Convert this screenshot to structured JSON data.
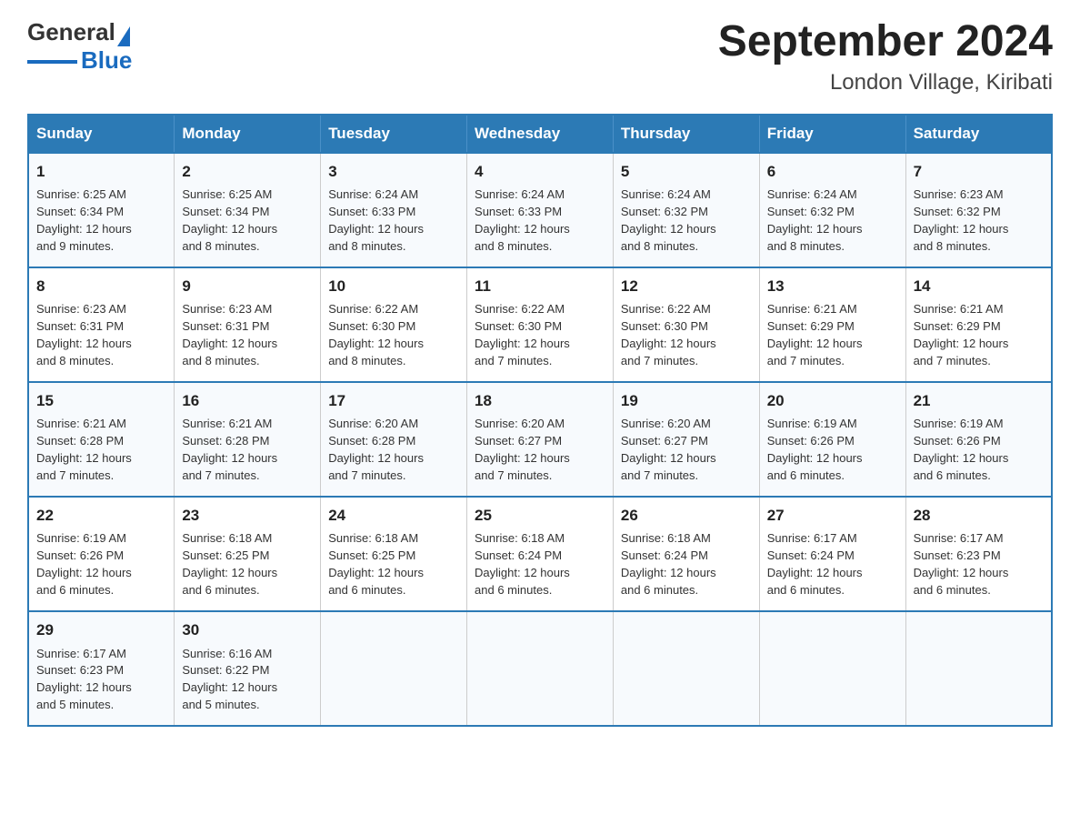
{
  "logo": {
    "text_general": "General",
    "text_blue": "Blue"
  },
  "title": "September 2024",
  "subtitle": "London Village, Kiribati",
  "days_header": [
    "Sunday",
    "Monday",
    "Tuesday",
    "Wednesday",
    "Thursday",
    "Friday",
    "Saturday"
  ],
  "weeks": [
    [
      {
        "day": "1",
        "sunrise": "6:25 AM",
        "sunset": "6:34 PM",
        "daylight": "12 hours and 9 minutes."
      },
      {
        "day": "2",
        "sunrise": "6:25 AM",
        "sunset": "6:34 PM",
        "daylight": "12 hours and 8 minutes."
      },
      {
        "day": "3",
        "sunrise": "6:24 AM",
        "sunset": "6:33 PM",
        "daylight": "12 hours and 8 minutes."
      },
      {
        "day": "4",
        "sunrise": "6:24 AM",
        "sunset": "6:33 PM",
        "daylight": "12 hours and 8 minutes."
      },
      {
        "day": "5",
        "sunrise": "6:24 AM",
        "sunset": "6:32 PM",
        "daylight": "12 hours and 8 minutes."
      },
      {
        "day": "6",
        "sunrise": "6:24 AM",
        "sunset": "6:32 PM",
        "daylight": "12 hours and 8 minutes."
      },
      {
        "day": "7",
        "sunrise": "6:23 AM",
        "sunset": "6:32 PM",
        "daylight": "12 hours and 8 minutes."
      }
    ],
    [
      {
        "day": "8",
        "sunrise": "6:23 AM",
        "sunset": "6:31 PM",
        "daylight": "12 hours and 8 minutes."
      },
      {
        "day": "9",
        "sunrise": "6:23 AM",
        "sunset": "6:31 PM",
        "daylight": "12 hours and 8 minutes."
      },
      {
        "day": "10",
        "sunrise": "6:22 AM",
        "sunset": "6:30 PM",
        "daylight": "12 hours and 8 minutes."
      },
      {
        "day": "11",
        "sunrise": "6:22 AM",
        "sunset": "6:30 PM",
        "daylight": "12 hours and 7 minutes."
      },
      {
        "day": "12",
        "sunrise": "6:22 AM",
        "sunset": "6:30 PM",
        "daylight": "12 hours and 7 minutes."
      },
      {
        "day": "13",
        "sunrise": "6:21 AM",
        "sunset": "6:29 PM",
        "daylight": "12 hours and 7 minutes."
      },
      {
        "day": "14",
        "sunrise": "6:21 AM",
        "sunset": "6:29 PM",
        "daylight": "12 hours and 7 minutes."
      }
    ],
    [
      {
        "day": "15",
        "sunrise": "6:21 AM",
        "sunset": "6:28 PM",
        "daylight": "12 hours and 7 minutes."
      },
      {
        "day": "16",
        "sunrise": "6:21 AM",
        "sunset": "6:28 PM",
        "daylight": "12 hours and 7 minutes."
      },
      {
        "day": "17",
        "sunrise": "6:20 AM",
        "sunset": "6:28 PM",
        "daylight": "12 hours and 7 minutes."
      },
      {
        "day": "18",
        "sunrise": "6:20 AM",
        "sunset": "6:27 PM",
        "daylight": "12 hours and 7 minutes."
      },
      {
        "day": "19",
        "sunrise": "6:20 AM",
        "sunset": "6:27 PM",
        "daylight": "12 hours and 7 minutes."
      },
      {
        "day": "20",
        "sunrise": "6:19 AM",
        "sunset": "6:26 PM",
        "daylight": "12 hours and 6 minutes."
      },
      {
        "day": "21",
        "sunrise": "6:19 AM",
        "sunset": "6:26 PM",
        "daylight": "12 hours and 6 minutes."
      }
    ],
    [
      {
        "day": "22",
        "sunrise": "6:19 AM",
        "sunset": "6:26 PM",
        "daylight": "12 hours and 6 minutes."
      },
      {
        "day": "23",
        "sunrise": "6:18 AM",
        "sunset": "6:25 PM",
        "daylight": "12 hours and 6 minutes."
      },
      {
        "day": "24",
        "sunrise": "6:18 AM",
        "sunset": "6:25 PM",
        "daylight": "12 hours and 6 minutes."
      },
      {
        "day": "25",
        "sunrise": "6:18 AM",
        "sunset": "6:24 PM",
        "daylight": "12 hours and 6 minutes."
      },
      {
        "day": "26",
        "sunrise": "6:18 AM",
        "sunset": "6:24 PM",
        "daylight": "12 hours and 6 minutes."
      },
      {
        "day": "27",
        "sunrise": "6:17 AM",
        "sunset": "6:24 PM",
        "daylight": "12 hours and 6 minutes."
      },
      {
        "day": "28",
        "sunrise": "6:17 AM",
        "sunset": "6:23 PM",
        "daylight": "12 hours and 6 minutes."
      }
    ],
    [
      {
        "day": "29",
        "sunrise": "6:17 AM",
        "sunset": "6:23 PM",
        "daylight": "12 hours and 5 minutes."
      },
      {
        "day": "30",
        "sunrise": "6:16 AM",
        "sunset": "6:22 PM",
        "daylight": "12 hours and 5 minutes."
      },
      null,
      null,
      null,
      null,
      null
    ]
  ],
  "labels": {
    "sunrise": "Sunrise:",
    "sunset": "Sunset:",
    "daylight": "Daylight:"
  }
}
